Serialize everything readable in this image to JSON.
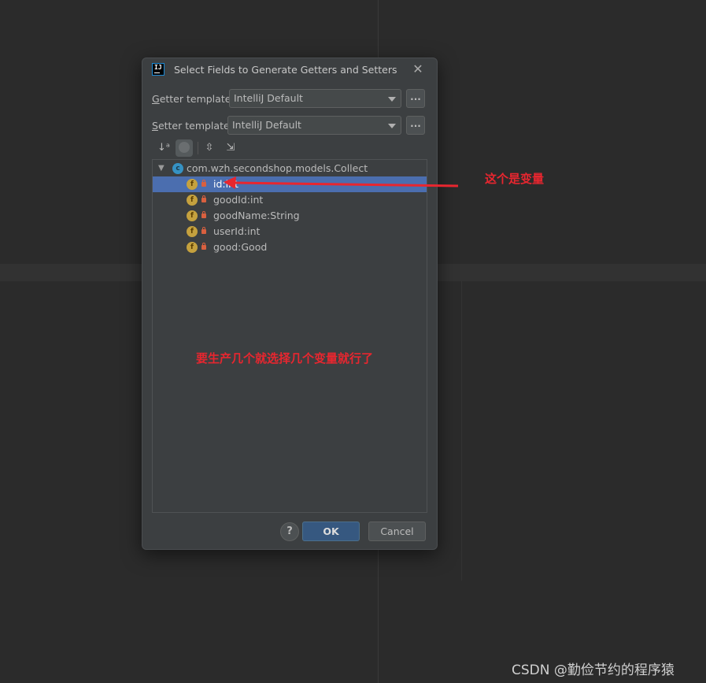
{
  "dialog": {
    "title": "Select Fields to Generate Getters and Setters",
    "close_glyph": "✕",
    "getter": {
      "label_mnemonic": "G",
      "label_rest": "etter template:",
      "value": "IntelliJ Default"
    },
    "setter": {
      "label_mnemonic": "S",
      "label_rest": "etter template:",
      "value": "IntelliJ Default"
    },
    "more_button": "...",
    "toolbar": {
      "sort_glyph": "↓ᵃ",
      "expand_glyph": "⇳",
      "collapse_glyph": "⇲"
    },
    "tree": {
      "class_name": "com.wzh.secondshop.models.Collect",
      "class_icon_letter": "c",
      "field_icon_letter": "f",
      "fields": [
        "id:int",
        "goodId:int",
        "goodName:String",
        "userId:int",
        "good:Good"
      ]
    },
    "help_glyph": "?",
    "ok_label": "OK",
    "cancel_label": "Cancel"
  },
  "annotations": {
    "variable_note": "这个是变量",
    "select_note": "要生产几个就选择几个变量就行了",
    "color": "#e8262f"
  },
  "watermark": "CSDN @勤俭节约的程序猿",
  "colors": {
    "selection": "#4b6eaf",
    "ok_button": "#365880",
    "background": "#2b2b2b",
    "dialog": "#3c3f41"
  }
}
